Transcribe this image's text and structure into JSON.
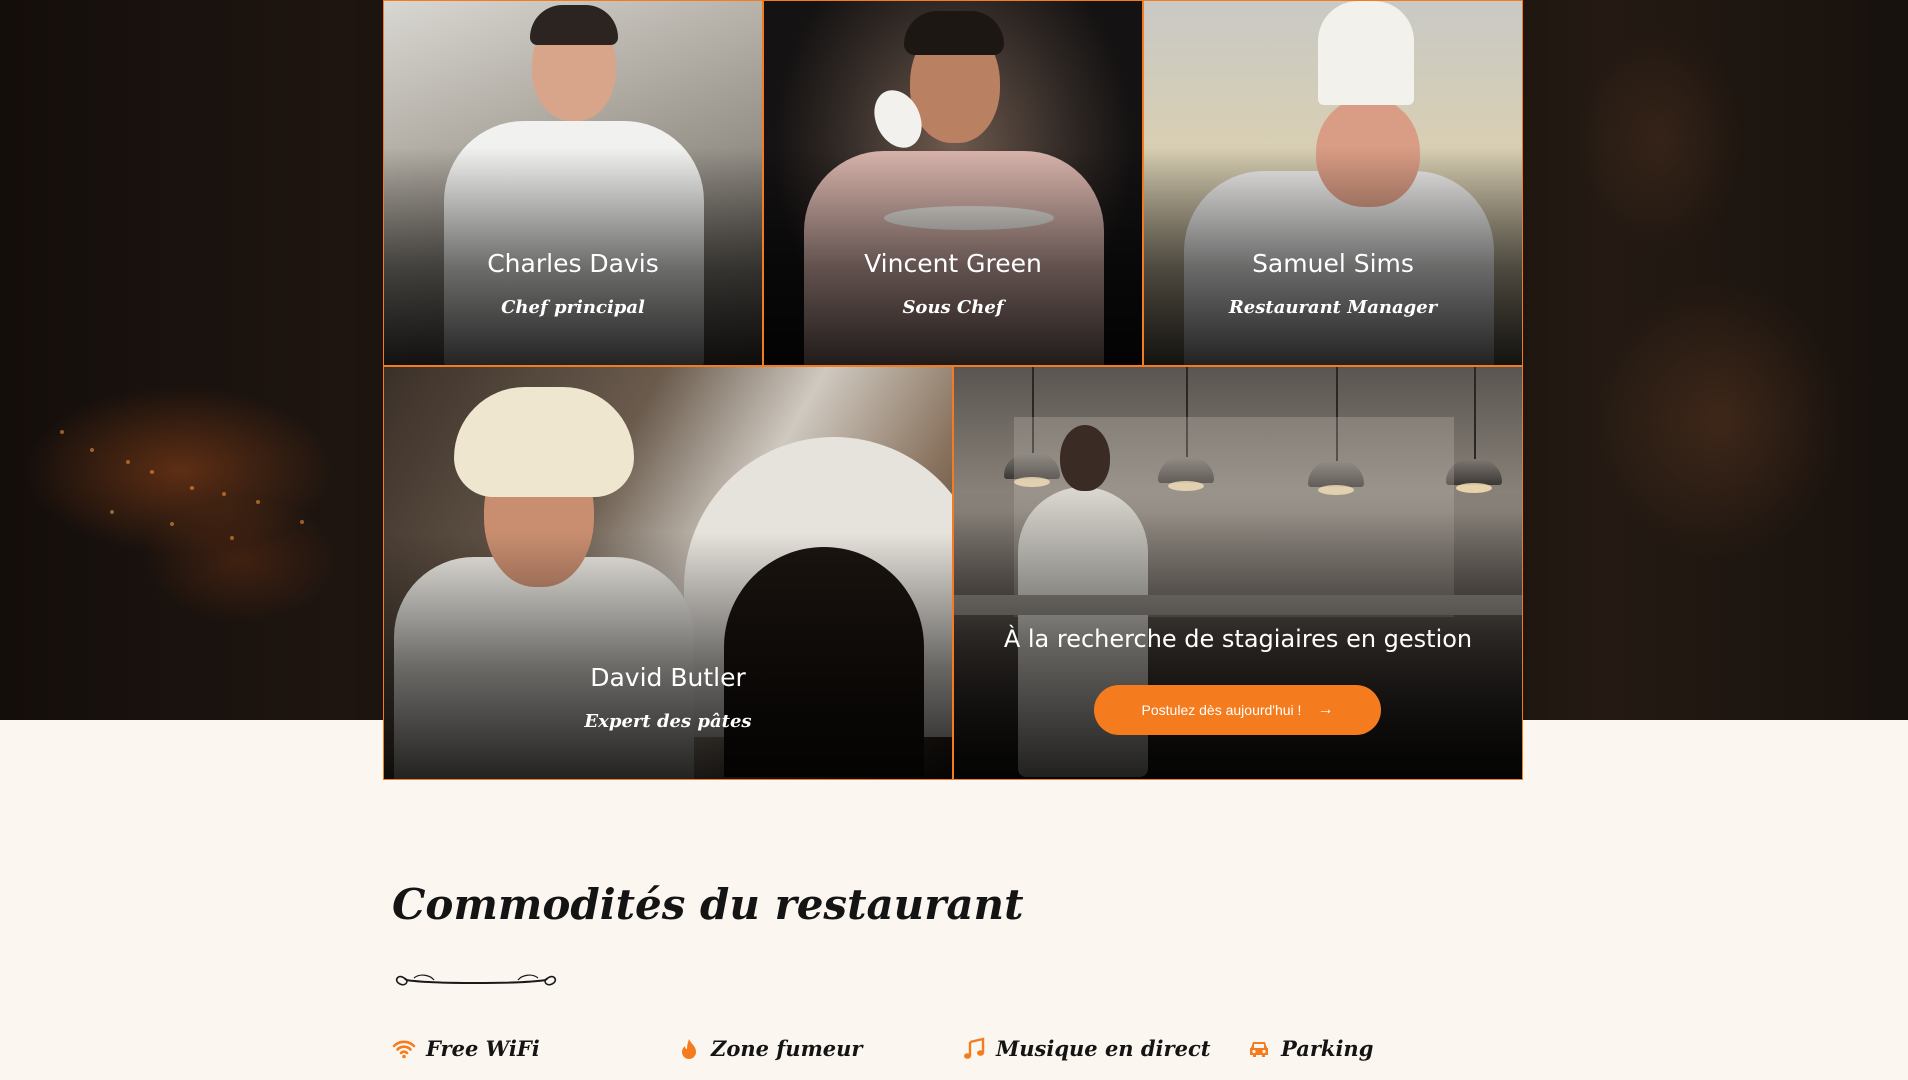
{
  "team": {
    "members": [
      {
        "name": "Charles Davis",
        "role": "Chef principal"
      },
      {
        "name": "Vincent Green",
        "role": "Sous Chef"
      },
      {
        "name": "Samuel Sims",
        "role": "Restaurant Manager"
      },
      {
        "name": "David Butler",
        "role": "Expert des pâtes"
      }
    ],
    "recruit": {
      "title": "À la recherche de stagiaires en gestion",
      "button_label": "Postulez dès aujourd'hui !",
      "button_icon": "arrow-right-icon"
    }
  },
  "amenities": {
    "title": "Commodités du restaurant",
    "items": [
      {
        "label": "Free WiFi",
        "icon": "wifi-icon"
      },
      {
        "label": "Zone fumeur",
        "icon": "flame-icon"
      },
      {
        "label": "Musique en direct",
        "icon": "music-icon"
      },
      {
        "label": "Parking",
        "icon": "car-icon"
      }
    ]
  },
  "colors": {
    "accent": "#f47c1e",
    "page_background": "#fcf6f1",
    "hero_background": "#140e0b",
    "heading": "#141414"
  }
}
